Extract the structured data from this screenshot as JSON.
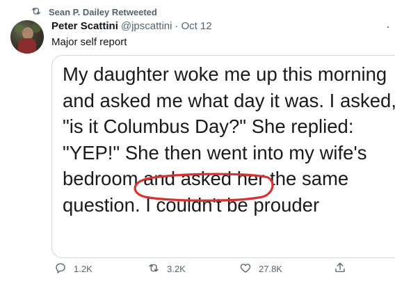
{
  "retweet_banner": {
    "text": "Sean P. Dailey Retweeted"
  },
  "tweet": {
    "author_name": "Peter Scattini",
    "handle": "@jpscattini",
    "separator": "·",
    "date": "Oct 12",
    "text": "Major self report",
    "more_icon": "more-icon"
  },
  "media": {
    "quote": "My daughter woke me up this morning and asked me what day it was. I asked, \"is it Columbus Day?\" She replied: \"YEP!\" She then went into my wife's bedroom and asked her the same question. I couldn't be prouder",
    "annotation_color": "#d6322f"
  },
  "actions": {
    "reply_count": "1.2K",
    "retweet_count": "3.2K",
    "like_count": "27.8K"
  },
  "colors": {
    "secondary_text": "#536471",
    "border": "#cfd9de"
  }
}
